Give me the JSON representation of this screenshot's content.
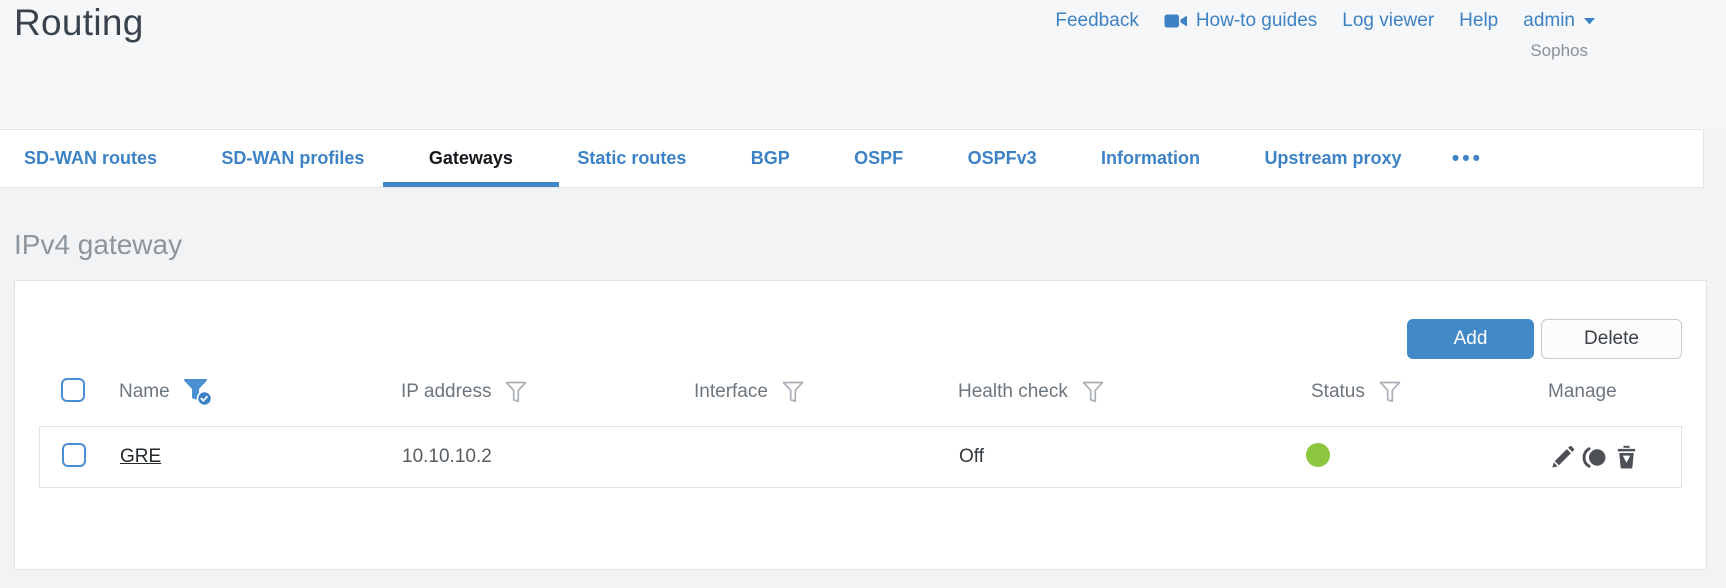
{
  "page": {
    "title": "Routing",
    "account_label": "Sophos"
  },
  "header": {
    "links": {
      "feedback": "Feedback",
      "howto": "How-to guides",
      "log_viewer": "Log viewer",
      "help": "Help",
      "user": "admin"
    }
  },
  "tabs": {
    "active_tab": "Gateways",
    "items": [
      {
        "label": "SD-WAN routes"
      },
      {
        "label": "SD-WAN profiles"
      },
      {
        "label": "Gateways"
      },
      {
        "label": "Static routes"
      },
      {
        "label": "BGP"
      },
      {
        "label": "OSPF"
      },
      {
        "label": "OSPFv3"
      },
      {
        "label": "Information"
      },
      {
        "label": "Upstream proxy"
      }
    ],
    "more_label": "•••"
  },
  "section": {
    "title": "IPv4 gateway"
  },
  "toolbar": {
    "add_label": "Add",
    "delete_label": "Delete"
  },
  "table": {
    "columns": {
      "name": "Name",
      "ip": "IP address",
      "interface": "Interface",
      "health": "Health check",
      "status": "Status",
      "manage": "Manage"
    },
    "filters": {
      "name": "active",
      "ip": "inactive",
      "interface": "inactive",
      "health": "inactive",
      "status": "inactive"
    },
    "rows": [
      {
        "name": "GRE",
        "ip_address": "10.10.10.2",
        "interface": "",
        "health_check": "Off",
        "status": "green",
        "actions": [
          "edit",
          "toggle-status",
          "delete"
        ]
      }
    ]
  },
  "colors": {
    "accent_blue": "#3d82c4",
    "add_button_blue": "#4189c7",
    "active_tab_underline": "#4187c6",
    "status_green": "#8dc63f",
    "active_filter_blue": "#4a90d2"
  }
}
